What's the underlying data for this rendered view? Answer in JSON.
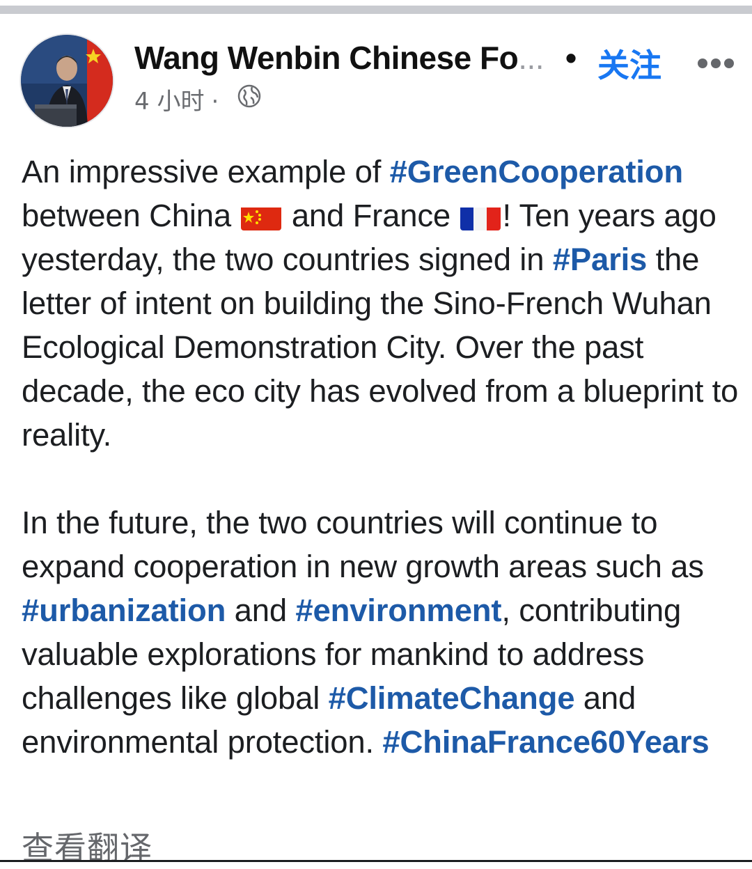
{
  "header": {
    "author_name": "Wang Wenbin Chinese Fo",
    "author_truncation": "...",
    "separator_dot": "•",
    "follow_label": "关注",
    "timestamp": "4 小时",
    "meta_separator": "·",
    "privacy_icon": "globe-icon",
    "more_icon": "more-options-icon"
  },
  "post": {
    "p1": {
      "t1": "An impressive example of ",
      "tag1": "#GreenCooperation",
      "t2": " between China ",
      "flag1": "flag-china-icon",
      "t3": " and France ",
      "flag2": "flag-france-icon",
      "t4": "! Ten years ago yesterday, the two countries signed in ",
      "tag2": "#Paris",
      "t5": " the letter of intent on building the Sino-French Wuhan Ecological Demonstration City. Over the past decade, the eco city has evolved from a blueprint to reality."
    },
    "p2": {
      "t1": "In the future, the two countries will continue to expand cooperation in new growth areas such as ",
      "tag1": "#urbanization",
      "t2": " and ",
      "tag2": "#environment",
      "t3": ", contributing valuable explorations for mankind to address challenges like global ",
      "tag3": "#ClimateChange",
      "t4": " and environmental protection. ",
      "tag4": "#ChinaFrance60Years"
    }
  },
  "footer": {
    "translate_label": "查看翻译"
  },
  "colors": {
    "hashtag": "#1d5aa8",
    "follow": "#1877f2",
    "text": "#1c1e21",
    "meta": "#6a6c70"
  }
}
